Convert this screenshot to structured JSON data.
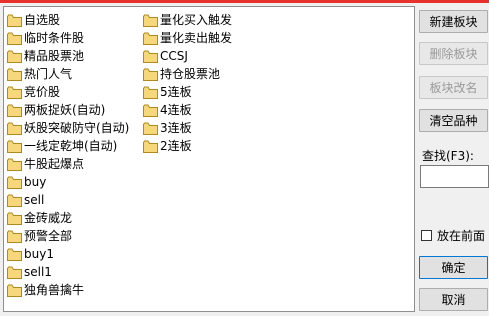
{
  "list": {
    "column1": [
      {
        "label": "自选股",
        "icon": "folder-icon"
      },
      {
        "label": "临时条件股",
        "icon": "folder-icon"
      },
      {
        "label": "精品股票池",
        "icon": "folder-icon"
      },
      {
        "label": "热门人气",
        "icon": "folder-icon"
      },
      {
        "label": "竞价股",
        "icon": "folder-icon"
      },
      {
        "label": "两板捉妖(自动)",
        "icon": "folder-icon"
      },
      {
        "label": "妖股突破防守(自动)",
        "icon": "folder-icon"
      },
      {
        "label": "一线定乾坤(自动)",
        "icon": "folder-icon"
      },
      {
        "label": "牛股起爆点",
        "icon": "folder-icon"
      },
      {
        "label": "buy",
        "icon": "folder-icon"
      },
      {
        "label": "sell",
        "icon": "folder-icon"
      },
      {
        "label": "金砖威龙",
        "icon": "folder-icon"
      },
      {
        "label": "预警全部",
        "icon": "folder-icon"
      },
      {
        "label": "buy1",
        "icon": "folder-icon"
      },
      {
        "label": "sell1",
        "icon": "folder-icon"
      },
      {
        "label": "独角兽擒牛",
        "icon": "folder-icon"
      }
    ],
    "column2": [
      {
        "label": "量化买入触发",
        "icon": "folder-icon"
      },
      {
        "label": "量化卖出触发",
        "icon": "folder-icon"
      },
      {
        "label": "CCSJ",
        "icon": "folder-icon"
      },
      {
        "label": "持仓股票池",
        "icon": "folder-icon"
      },
      {
        "label": "5连板",
        "icon": "folder-icon"
      },
      {
        "label": "4连板",
        "icon": "folder-icon"
      },
      {
        "label": "3连板",
        "icon": "folder-icon"
      },
      {
        "label": "2连板",
        "icon": "folder-icon"
      }
    ]
  },
  "buttons": {
    "new_block": "新建板块",
    "delete_block": "删除板块",
    "rename_block": "板块改名",
    "clear_items": "清空品种",
    "ok": "确定",
    "cancel": "取消"
  },
  "search": {
    "label": "查找(F3):",
    "value": ""
  },
  "options": {
    "put_first_label": "放在前面",
    "put_first_checked": false
  },
  "colors": {
    "accent": "#e8312c",
    "folder_fill": "#f6d77a",
    "folder_stroke": "#b08a1e"
  }
}
